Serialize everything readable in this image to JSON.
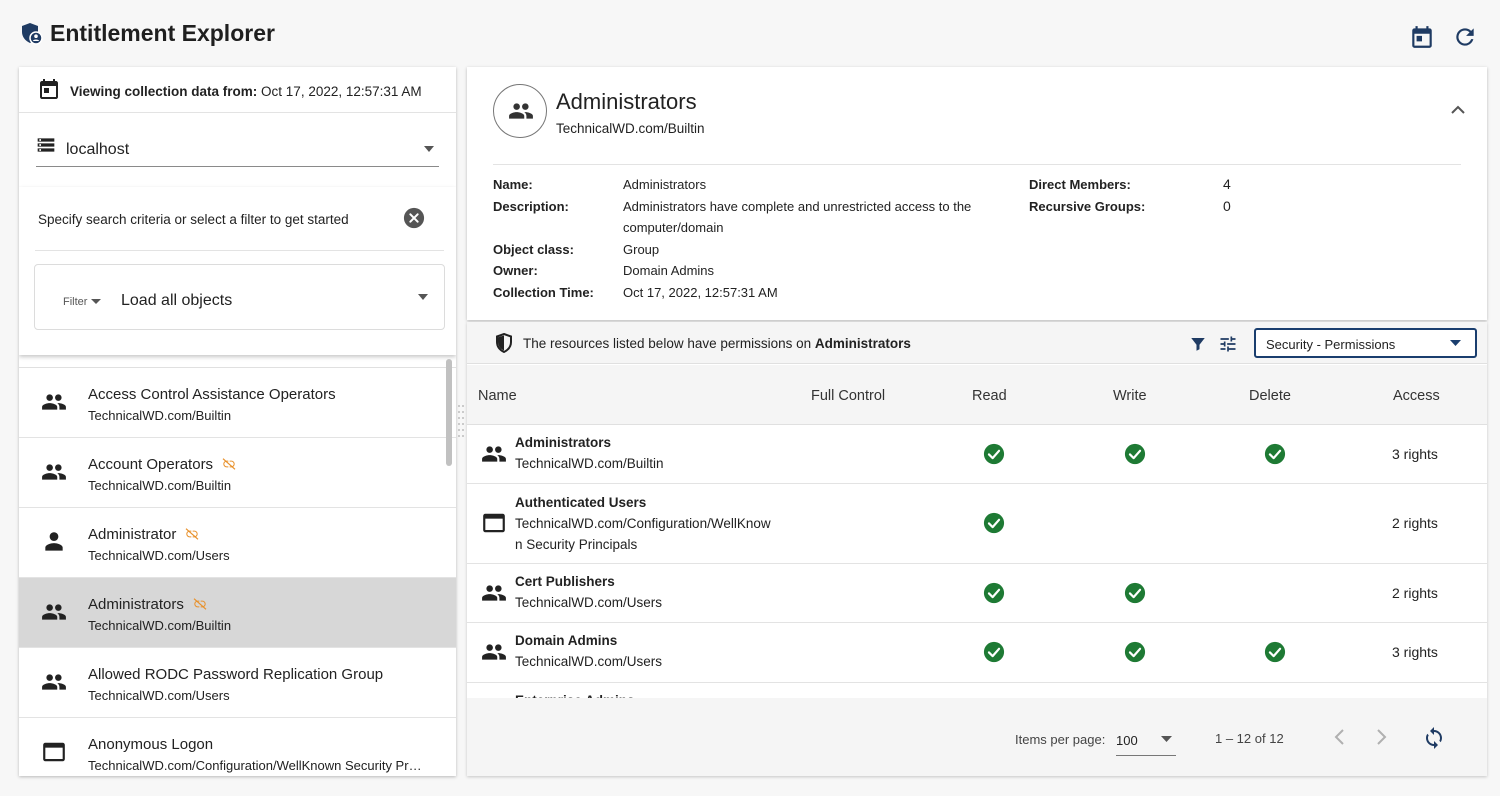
{
  "app": {
    "title": "Entitlement Explorer"
  },
  "collection": {
    "label": "Viewing collection data from:",
    "value": "Oct 17, 2022, 12:57:31 AM"
  },
  "server": {
    "selected": "localhost"
  },
  "search": {
    "hint": "Specify search criteria or select a filter to get started",
    "filter_label": "Filter",
    "filter_value": "Load all objects"
  },
  "objects": [
    {
      "name": "Access Control Assistance Operators",
      "path": "TechnicalWD.com/Builtin",
      "icon": "group-icon",
      "unlinked": false,
      "selected": false
    },
    {
      "name": "Account Operators",
      "path": "TechnicalWD.com/Builtin",
      "icon": "group-icon",
      "unlinked": true,
      "selected": false
    },
    {
      "name": "Administrator",
      "path": "TechnicalWD.com/Users",
      "icon": "person-icon",
      "unlinked": true,
      "selected": false
    },
    {
      "name": "Administrators",
      "path": "TechnicalWD.com/Builtin",
      "icon": "group-icon",
      "unlinked": true,
      "selected": true
    },
    {
      "name": "Allowed RODC Password Replication Group",
      "path": "TechnicalWD.com/Users",
      "icon": "group-icon",
      "unlinked": false,
      "selected": false
    },
    {
      "name": "Anonymous Logon",
      "path": "TechnicalWD.com/Configuration/WellKnown Security Principals",
      "icon": "window-icon",
      "unlinked": false,
      "selected": false
    }
  ],
  "detail": {
    "title": "Administrators",
    "subtitle": "TechnicalWD.com/Builtin",
    "fields": {
      "name_key": "Name:",
      "name_val": "Administrators",
      "desc_key": "Description:",
      "desc_val": "Administrators have complete and unrestricted access to the computer/domain",
      "class_key": "Object class:",
      "class_val": "Group",
      "owner_key": "Owner:",
      "owner_val": "Domain Admins",
      "time_key": "Collection Time:",
      "time_val": "Oct 17, 2022, 12:57:31 AM",
      "members_key": "Direct Members:",
      "members_val": "4",
      "recursive_key": "Recursive Groups:",
      "recursive_val": "0"
    }
  },
  "permissions": {
    "info_prefix": "The resources listed below have permissions on",
    "info_target": "Administrators",
    "view_select": "Security - Permissions",
    "columns": [
      "Name",
      "Full Control",
      "Read",
      "Write",
      "Delete",
      "Access"
    ],
    "rows": [
      {
        "name": "Administrators",
        "path": "TechnicalWD.com/Builtin",
        "icon": "group-icon",
        "read": true,
        "write": true,
        "delete": true,
        "access": "3 rights"
      },
      {
        "name": "Authenticated Users",
        "path": "TechnicalWD.com/Configuration/WellKnown Security Principals",
        "icon": "window-icon",
        "read": true,
        "write": false,
        "delete": false,
        "access": "2 rights"
      },
      {
        "name": "Cert Publishers",
        "path": "TechnicalWD.com/Users",
        "icon": "group-icon",
        "read": true,
        "write": true,
        "delete": false,
        "access": "2 rights"
      },
      {
        "name": "Domain Admins",
        "path": "TechnicalWD.com/Users",
        "icon": "group-icon",
        "read": true,
        "write": true,
        "delete": true,
        "access": "3 rights"
      },
      {
        "name": "Enterprise Admins",
        "path": "",
        "icon": "group-icon",
        "read": false,
        "write": false,
        "delete": false,
        "access": ""
      }
    ]
  },
  "paginator": {
    "label": "Items per page:",
    "page_size": "100",
    "range": "1 – 12 of 12"
  },
  "colors": {
    "check": "#1e7a34",
    "unlink": "#e8912b",
    "select_border": "#1a3e6e",
    "selected_row": "#d7d7d7"
  }
}
